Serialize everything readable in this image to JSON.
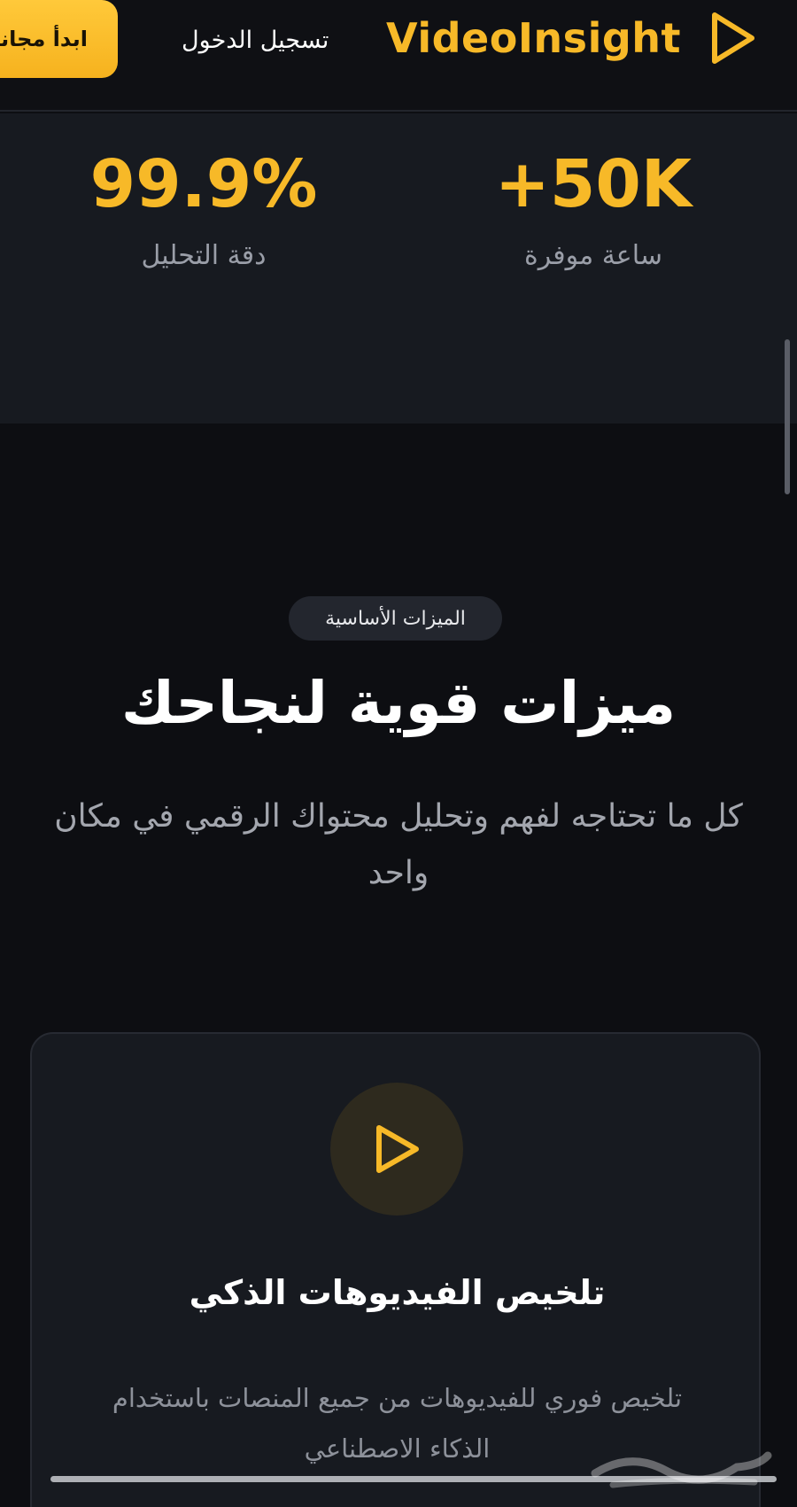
{
  "header": {
    "cta_label": "ابدأ مجاناً",
    "login_label": "تسجيل الدخول",
    "brand_name": "VideoInsight",
    "brand_icon": "play-outline-icon"
  },
  "stats": [
    {
      "value": "+50K",
      "label": "ساعة موفرة"
    },
    {
      "value": "99.9%",
      "label": "دقة التحليل"
    }
  ],
  "features": {
    "badge": "الميزات الأساسية",
    "title": "ميزات قوية لنجاحك",
    "subtitle": "كل ما تحتاجه لفهم وتحليل محتواك الرقمي في مكان واحد",
    "cards": [
      {
        "icon": "play-outline-icon",
        "title": "تلخيص الفيديوهات الذكي",
        "description": "تلخيص فوري للفيديوهات من جميع المنصات باستخدام الذكاء الاصطناعي"
      }
    ]
  },
  "colors": {
    "accent": "#f7b928",
    "background": "#0d0e12",
    "surface": "#171a20"
  }
}
